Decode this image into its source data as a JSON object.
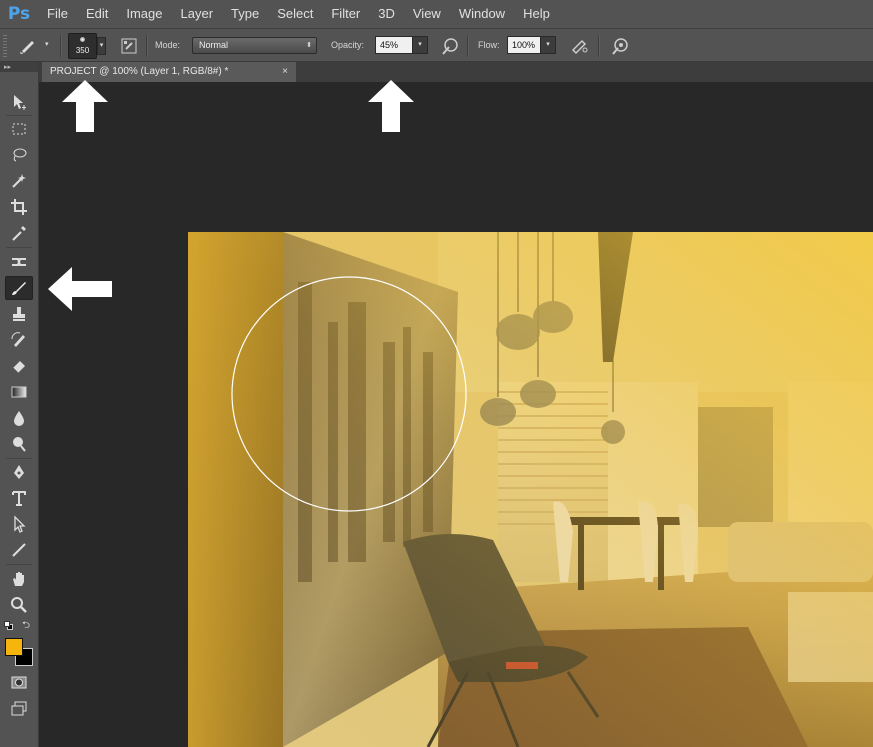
{
  "app": {
    "logo": "Ps"
  },
  "menu": [
    "File",
    "Edit",
    "Image",
    "Layer",
    "Type",
    "Select",
    "Filter",
    "3D",
    "View",
    "Window",
    "Help"
  ],
  "options": {
    "brush_size": "350",
    "mode_label": "Mode:",
    "mode_value": "Normal",
    "opacity_label": "Opacity:",
    "opacity_value": "45%",
    "flow_label": "Flow:",
    "flow_value": "100%"
  },
  "document": {
    "tab_title": "PROJECT @ 100% (Layer 1, RGB/8#) *",
    "close_glyph": "×"
  },
  "toolbar": {
    "header_glyph": "▸▸",
    "tools": [
      "move-icon",
      "marquee-icon",
      "lasso-icon",
      "magic-wand-icon",
      "crop-icon",
      "eyedropper-icon",
      "healing-icon",
      "brush-icon",
      "stamp-icon",
      "history-brush-icon",
      "eraser-icon",
      "gradient-icon",
      "blur-icon",
      "dodge-icon",
      "pen-icon",
      "type-icon",
      "path-select-icon",
      "line-icon",
      "hand-icon",
      "zoom-icon"
    ],
    "active_tool": "brush-icon",
    "foreground_color": "#f5b50d",
    "background_color": "#000000"
  },
  "colors": {
    "chrome": "#535353",
    "workspace": "#282828",
    "accent": "#4fa3e8"
  }
}
